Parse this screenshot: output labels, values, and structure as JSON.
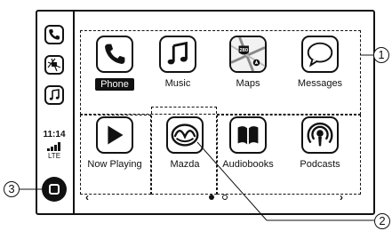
{
  "sidebar": {
    "items": [
      {
        "name": "phone",
        "icon": "phone-icon"
      },
      {
        "name": "maps",
        "icon": "map-icon"
      },
      {
        "name": "music",
        "icon": "music-note-icon"
      }
    ],
    "status": {
      "time": "11:14",
      "network": "LTE",
      "signal_icon": "signal-bars-icon"
    },
    "home_icon": "home-button-icon"
  },
  "apps": [
    {
      "label": "Phone",
      "icon": "phone-icon",
      "selected": true
    },
    {
      "label": "Music",
      "icon": "music-note-icon"
    },
    {
      "label": "Maps",
      "icon": "map-icon",
      "sign": "280"
    },
    {
      "label": "Messages",
      "icon": "speech-bubble-icon"
    },
    {
      "label": "Now Playing",
      "icon": "play-icon"
    },
    {
      "label": "Mazda",
      "icon": "mazda-logo-icon"
    },
    {
      "label": "Audiobooks",
      "icon": "open-book-icon"
    },
    {
      "label": "Podcasts",
      "icon": "podcast-icon"
    }
  ],
  "pager": {
    "left_arrow": "‹",
    "right_arrow": "›",
    "pages": 2,
    "current": 1
  },
  "callouts": {
    "one": "1",
    "two": "2",
    "three": "3"
  },
  "colors": {
    "ink": "#111111",
    "background": "#ffffff"
  }
}
